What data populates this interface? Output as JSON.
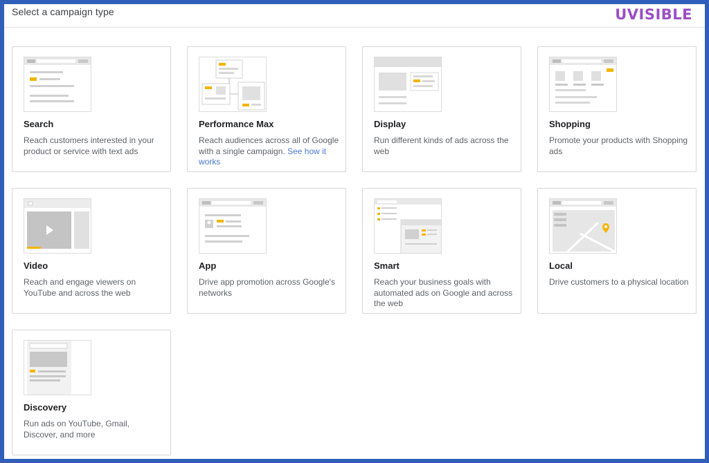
{
  "header": {
    "title": "Select a campaign type",
    "brand": "UVISIBLE"
  },
  "cards": [
    {
      "title": "Search",
      "description": "Reach customers interested in your product or service with text ads",
      "thumb_icon": "search-ad-preview-icon"
    },
    {
      "title": "Performance Max",
      "description": "Reach audiences across all of Google with a single campaign.",
      "link_text": "See how it works",
      "thumb_icon": "performance-max-preview-icon"
    },
    {
      "title": "Display",
      "description": "Run different kinds of ads across the web",
      "thumb_icon": "display-ad-preview-icon"
    },
    {
      "title": "Shopping",
      "description": "Promote your products with Shopping ads",
      "thumb_icon": "shopping-ad-preview-icon"
    },
    {
      "title": "Video",
      "description": "Reach and engage viewers on YouTube and across the web",
      "thumb_icon": "video-ad-preview-icon"
    },
    {
      "title": "App",
      "description": "Drive app promotion across Google's networks",
      "thumb_icon": "app-ad-preview-icon"
    },
    {
      "title": "Smart",
      "description": "Reach your business goals with automated ads on Google and across the web",
      "thumb_icon": "smart-ad-preview-icon"
    },
    {
      "title": "Local",
      "description": "Drive customers to a physical location",
      "thumb_icon": "local-ad-preview-icon"
    },
    {
      "title": "Discovery",
      "description": "Run ads on YouTube, Gmail, Discover, and more",
      "thumb_icon": "discovery-ad-preview-icon"
    }
  ],
  "colors": {
    "accent_yellow": "#f4b400",
    "frame_border": "#2f5fb8",
    "brand": "#9b4fc6",
    "link": "#4a78d4"
  }
}
